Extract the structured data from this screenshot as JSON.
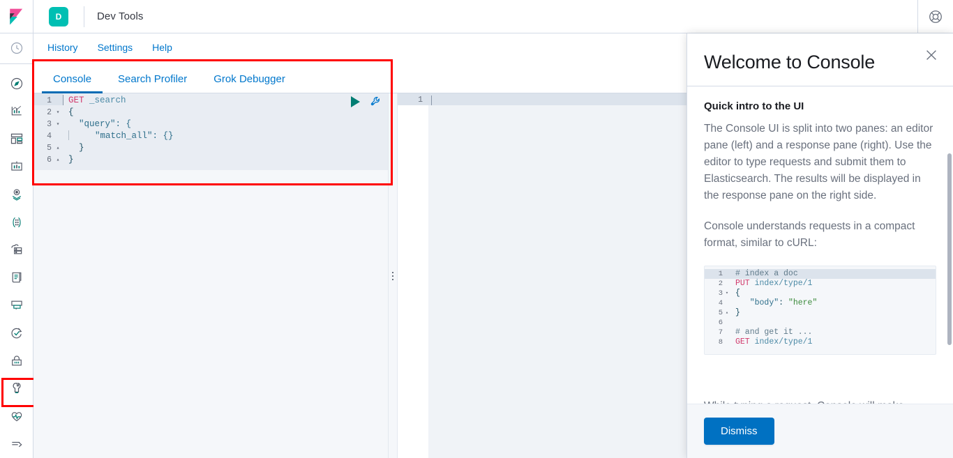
{
  "header": {
    "logo_icon": "kibana-logo-icon",
    "app_badge": "D",
    "app_title": "Dev Tools",
    "help_icon": "help-life-ring-icon"
  },
  "sidebar": {
    "items": [
      {
        "name": "recently-viewed",
        "icon": "clock-icon"
      },
      {
        "name": "discover",
        "icon": "compass-icon"
      },
      {
        "name": "visualize",
        "icon": "bar-chart-icon"
      },
      {
        "name": "dashboard",
        "icon": "dashboard-grid-icon"
      },
      {
        "name": "canvas",
        "icon": "presentation-icon"
      },
      {
        "name": "maps",
        "icon": "map-pin-icon"
      },
      {
        "name": "machine-learning",
        "icon": "graph-nodes-icon"
      },
      {
        "name": "infrastructure",
        "icon": "storage-stack-icon"
      },
      {
        "name": "logs",
        "icon": "scroll-document-icon"
      },
      {
        "name": "apm",
        "icon": "monitor-screen-icon"
      },
      {
        "name": "uptime",
        "icon": "uptime-check-icon"
      },
      {
        "name": "siem",
        "icon": "lock-icon"
      },
      {
        "name": "dev-tools",
        "icon": "wrench-icon",
        "selected": true
      },
      {
        "name": "stack-monitoring",
        "icon": "heart-pulse-icon"
      },
      {
        "name": "collapse-nav",
        "icon": "arrow-collapse-icon"
      }
    ]
  },
  "nav": {
    "links": [
      {
        "label": "History"
      },
      {
        "label": "Settings"
      },
      {
        "label": "Help"
      }
    ]
  },
  "tabs": [
    {
      "label": "Console",
      "active": true
    },
    {
      "label": "Search Profiler",
      "active": false
    },
    {
      "label": "Grok Debugger",
      "active": false
    }
  ],
  "editor": {
    "run_icon": "play-triangle-icon",
    "wrench_icon": "wrench-icon",
    "lines": [
      {
        "no": "1",
        "fold": "",
        "method": "GET",
        "rest": " _search"
      },
      {
        "no": "2",
        "fold": "▾",
        "text": "{"
      },
      {
        "no": "3",
        "fold": "▾",
        "text": "  \"query\": {"
      },
      {
        "no": "4",
        "fold": "",
        "text": "    \"match_all\": {}"
      },
      {
        "no": "5",
        "fold": "▴",
        "text": "  }"
      },
      {
        "no": "6",
        "fold": "▴",
        "text": "}"
      }
    ]
  },
  "response": {
    "line_numbers": [
      "1"
    ]
  },
  "resizer": {
    "icon": "grip-dots-icon"
  },
  "flyout": {
    "title": "Welcome to Console",
    "close_icon": "close-icon",
    "section_heading": "Quick intro to the UI",
    "paragraph_1": "The Console UI is split into two panes: an editor pane (left) and a response pane (right). Use the editor to type requests and submit them to Elasticsearch. The results will be displayed in the response pane on the right side.",
    "paragraph_2": "Console understands requests in a compact format, similar to cURL:",
    "paragraph_3": "While typing a request, Console will make suggestions which you can then accept by",
    "snippet_lines": [
      {
        "no": "1",
        "fold": "",
        "type": "comment",
        "text": "# index a doc"
      },
      {
        "no": "2",
        "fold": "",
        "type": "request",
        "method": "PUT",
        "rest": " index/type/1"
      },
      {
        "no": "3",
        "fold": "▾",
        "type": "plain",
        "text": "{"
      },
      {
        "no": "4",
        "fold": "",
        "type": "kv",
        "key": "\"body\"",
        "value": "\"here\""
      },
      {
        "no": "5",
        "fold": "▴",
        "type": "plain",
        "text": "}"
      },
      {
        "no": "6",
        "fold": "",
        "type": "plain",
        "text": ""
      },
      {
        "no": "7",
        "fold": "",
        "type": "comment",
        "text": "# and get it ..."
      },
      {
        "no": "8",
        "fold": "",
        "type": "request",
        "method": "GET",
        "rest": " index/type/1"
      }
    ],
    "dismiss_label": "Dismiss"
  },
  "colors": {
    "brand_teal": "#00BFB3",
    "link_blue": "#0077CC",
    "tab_underline": "#006BB4",
    "button_blue": "#0071C2",
    "annotation_red": "#FF0000",
    "run_green": "#017D73"
  }
}
